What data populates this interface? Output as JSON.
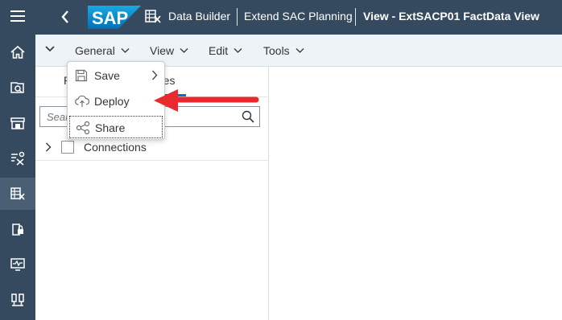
{
  "shell": {
    "logo_text": "SAP",
    "breadcrumb_1": "Data Builder",
    "breadcrumb_2": "Extend SAC Planning",
    "breadcrumb_3": "View - ExtSACP01 FactData View"
  },
  "rail": {
    "icons": [
      "menu-icon",
      "home-icon",
      "catalog-search-icon",
      "data-marketplace-icon",
      "business-builder-icon",
      "data-builder-icon",
      "security-icon",
      "monitor-icon",
      "connections-icon"
    ]
  },
  "menubar": {
    "items": [
      "General",
      "View",
      "Edit",
      "Tools"
    ]
  },
  "panel": {
    "tab_left": "R",
    "tab_right": "rces",
    "search_placeholder": "Sear",
    "tree_item": "Connections"
  },
  "dropdown": {
    "items": [
      {
        "label": "Save",
        "icon": "save-icon",
        "submenu": true
      },
      {
        "label": "Deploy",
        "icon": "deploy-icon",
        "submenu": false
      },
      {
        "label": "Share",
        "icon": "share-icon",
        "submenu": false
      }
    ]
  },
  "colors": {
    "shell_bg": "#354a5f",
    "menubar_bg": "#eef3f8",
    "accent": "#0a6ed1",
    "annotation": "#e8292e"
  }
}
